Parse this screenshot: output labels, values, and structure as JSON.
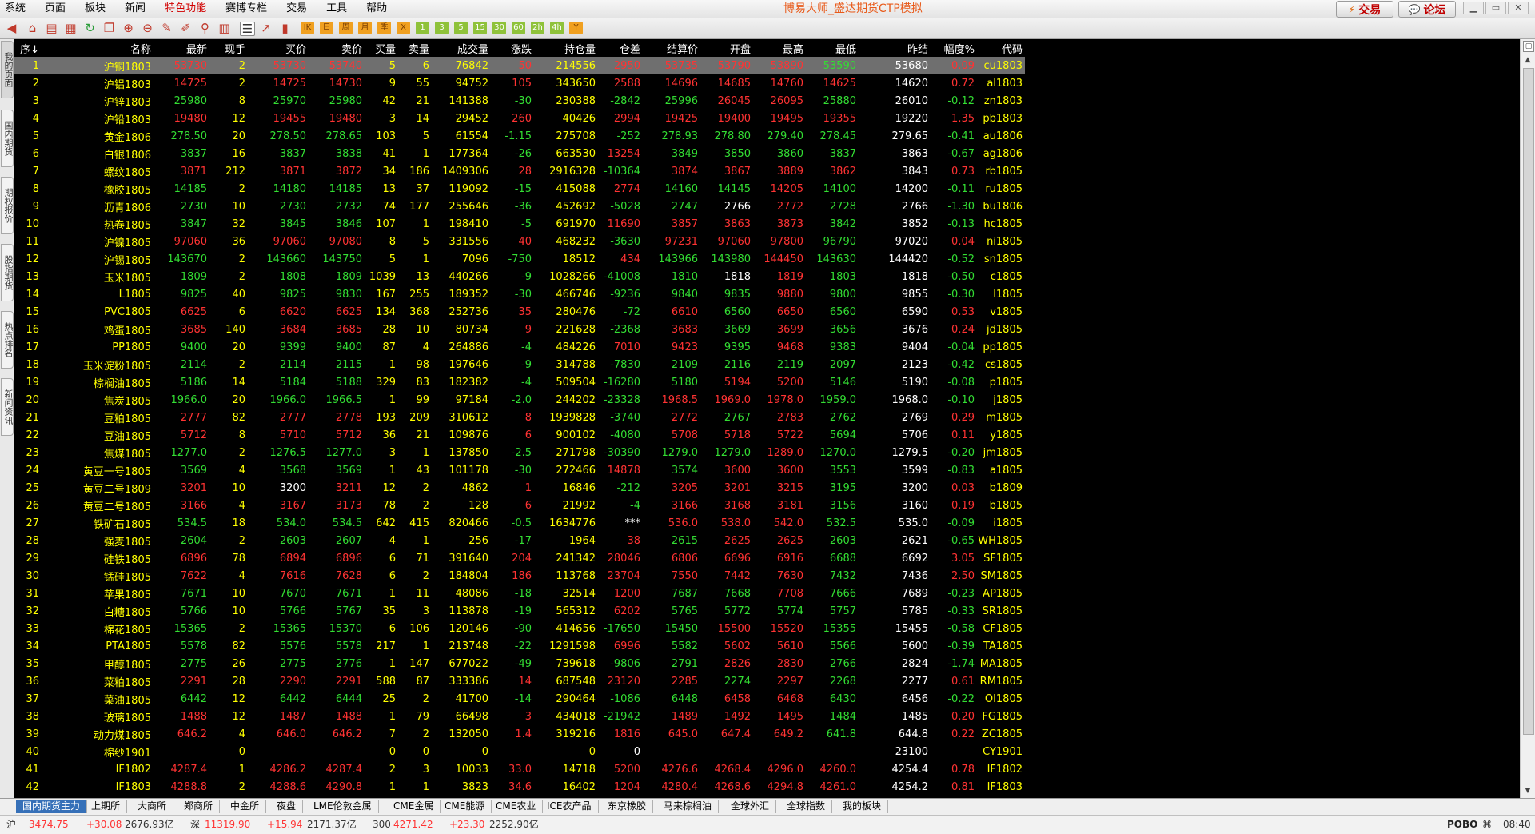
{
  "menu": {
    "items": [
      "系统",
      "页面",
      "板块",
      "新闻",
      "特色功能",
      "赛博专栏",
      "交易",
      "工具",
      "帮助"
    ],
    "highlight_index": 4
  },
  "app": {
    "title": "博易大师_盛达期货CTP模拟"
  },
  "top_buttons": {
    "trade": "交易",
    "forum": "论坛"
  },
  "toolbar": {
    "labels": [
      "IK",
      "日",
      "周",
      "月",
      "季",
      "X",
      "1",
      "3",
      "5",
      "15",
      "30",
      "60",
      "2h",
      "4h",
      "Y"
    ]
  },
  "sidebar": {
    "tabs": [
      "我的页面",
      "国内期货",
      "期权报价",
      "股指期货",
      "热点排名",
      "新闻资讯"
    ]
  },
  "table": {
    "headers": [
      "序↓",
      "名称",
      "最新",
      "现手",
      "买价",
      "卖价",
      "买量",
      "卖量",
      "成交量",
      "涨跌",
      "持仓量",
      "仓差",
      "结算价",
      "开盘",
      "最高",
      "最低",
      "昨结",
      "幅度%",
      "代码"
    ],
    "selected_index": 0,
    "rows": [
      [
        "1",
        "沪铜1803",
        "53730",
        "2",
        "53730",
        "53740",
        "5",
        "6",
        "76842",
        "50",
        "214556",
        "2950",
        "53735",
        "53790",
        "53890",
        "53590",
        "53680",
        "0.09",
        "cu1803"
      ],
      [
        "2",
        "沪铝1803",
        "14725",
        "2",
        "14725",
        "14730",
        "9",
        "55",
        "94752",
        "105",
        "343650",
        "2588",
        "14696",
        "14685",
        "14760",
        "14625",
        "14620",
        "0.72",
        "al1803"
      ],
      [
        "3",
        "沪锌1803",
        "25980",
        "8",
        "25970",
        "25980",
        "42",
        "21",
        "141388",
        "-30",
        "230388",
        "-2842",
        "25996",
        "26045",
        "26095",
        "25880",
        "26010",
        "-0.12",
        "zn1803"
      ],
      [
        "4",
        "沪铅1803",
        "19480",
        "12",
        "19455",
        "19480",
        "3",
        "14",
        "29452",
        "260",
        "40426",
        "2994",
        "19425",
        "19400",
        "19495",
        "19355",
        "19220",
        "1.35",
        "pb1803"
      ],
      [
        "5",
        "黄金1806",
        "278.50",
        "20",
        "278.50",
        "278.65",
        "103",
        "5",
        "61554",
        "-1.15",
        "275708",
        "-252",
        "278.93",
        "278.80",
        "279.40",
        "278.45",
        "279.65",
        "-0.41",
        "au1806"
      ],
      [
        "6",
        "白银1806",
        "3837",
        "16",
        "3837",
        "3838",
        "41",
        "1",
        "177364",
        "-26",
        "663530",
        "13254",
        "3849",
        "3850",
        "3860",
        "3837",
        "3863",
        "-0.67",
        "ag1806"
      ],
      [
        "7",
        "螺纹1805",
        "3871",
        "212",
        "3871",
        "3872",
        "34",
        "186",
        "1409306",
        "28",
        "2916328",
        "-10364",
        "3874",
        "3867",
        "3889",
        "3862",
        "3843",
        "0.73",
        "rb1805"
      ],
      [
        "8",
        "橡胶1805",
        "14185",
        "2",
        "14180",
        "14185",
        "13",
        "37",
        "119092",
        "-15",
        "415088",
        "2774",
        "14160",
        "14145",
        "14205",
        "14100",
        "14200",
        "-0.11",
        "ru1805"
      ],
      [
        "9",
        "沥青1806",
        "2730",
        "10",
        "2730",
        "2732",
        "74",
        "177",
        "255646",
        "-36",
        "452692",
        "-5028",
        "2747",
        "2766",
        "2772",
        "2728",
        "2766",
        "-1.30",
        "bu1806"
      ],
      [
        "10",
        "热卷1805",
        "3847",
        "32",
        "3845",
        "3846",
        "107",
        "1",
        "198410",
        "-5",
        "691970",
        "11690",
        "3857",
        "3863",
        "3873",
        "3842",
        "3852",
        "-0.13",
        "hc1805"
      ],
      [
        "11",
        "沪镍1805",
        "97060",
        "36",
        "97060",
        "97080",
        "8",
        "5",
        "331556",
        "40",
        "468232",
        "-3630",
        "97231",
        "97060",
        "97800",
        "96790",
        "97020",
        "0.04",
        "ni1805"
      ],
      [
        "12",
        "沪锡1805",
        "143670",
        "2",
        "143660",
        "143750",
        "5",
        "1",
        "7096",
        "-750",
        "18512",
        "434",
        "143966",
        "143980",
        "144450",
        "143630",
        "144420",
        "-0.52",
        "sn1805"
      ],
      [
        "13",
        "玉米1805",
        "1809",
        "2",
        "1808",
        "1809",
        "1039",
        "13",
        "440266",
        "-9",
        "1028266",
        "-41008",
        "1810",
        "1818",
        "1819",
        "1803",
        "1818",
        "-0.50",
        "c1805"
      ],
      [
        "14",
        "L1805",
        "9825",
        "40",
        "9825",
        "9830",
        "167",
        "255",
        "189352",
        "-30",
        "466746",
        "-9236",
        "9840",
        "9835",
        "9880",
        "9800",
        "9855",
        "-0.30",
        "l1805"
      ],
      [
        "15",
        "PVC1805",
        "6625",
        "6",
        "6620",
        "6625",
        "134",
        "368",
        "252736",
        "35",
        "280476",
        "-72",
        "6610",
        "6560",
        "6650",
        "6560",
        "6590",
        "0.53",
        "v1805"
      ],
      [
        "16",
        "鸡蛋1805",
        "3685",
        "140",
        "3684",
        "3685",
        "28",
        "10",
        "80734",
        "9",
        "221628",
        "-2368",
        "3683",
        "3669",
        "3699",
        "3656",
        "3676",
        "0.24",
        "jd1805"
      ],
      [
        "17",
        "PP1805",
        "9400",
        "20",
        "9399",
        "9400",
        "87",
        "4",
        "264886",
        "-4",
        "484226",
        "7010",
        "9423",
        "9395",
        "9468",
        "9383",
        "9404",
        "-0.04",
        "pp1805"
      ],
      [
        "18",
        "玉米淀粉1805",
        "2114",
        "2",
        "2114",
        "2115",
        "1",
        "98",
        "197646",
        "-9",
        "314788",
        "-7830",
        "2109",
        "2116",
        "2119",
        "2097",
        "2123",
        "-0.42",
        "cs1805"
      ],
      [
        "19",
        "棕榈油1805",
        "5186",
        "14",
        "5184",
        "5188",
        "329",
        "83",
        "182382",
        "-4",
        "509504",
        "-16280",
        "5180",
        "5194",
        "5200",
        "5146",
        "5190",
        "-0.08",
        "p1805"
      ],
      [
        "20",
        "焦炭1805",
        "1966.0",
        "20",
        "1966.0",
        "1966.5",
        "1",
        "99",
        "97184",
        "-2.0",
        "244202",
        "-23328",
        "1968.5",
        "1969.0",
        "1978.0",
        "1959.0",
        "1968.0",
        "-0.10",
        "j1805"
      ],
      [
        "21",
        "豆粕1805",
        "2777",
        "82",
        "2777",
        "2778",
        "193",
        "209",
        "310612",
        "8",
        "1939828",
        "-3740",
        "2772",
        "2767",
        "2783",
        "2762",
        "2769",
        "0.29",
        "m1805"
      ],
      [
        "22",
        "豆油1805",
        "5712",
        "8",
        "5710",
        "5712",
        "36",
        "21",
        "109876",
        "6",
        "900102",
        "-4080",
        "5708",
        "5718",
        "5722",
        "5694",
        "5706",
        "0.11",
        "y1805"
      ],
      [
        "23",
        "焦煤1805",
        "1277.0",
        "2",
        "1276.5",
        "1277.0",
        "3",
        "1",
        "137850",
        "-2.5",
        "271798",
        "-30390",
        "1279.0",
        "1279.0",
        "1289.0",
        "1270.0",
        "1279.5",
        "-0.20",
        "jm1805"
      ],
      [
        "24",
        "黄豆一号1805",
        "3569",
        "4",
        "3568",
        "3569",
        "1",
        "43",
        "101178",
        "-30",
        "272466",
        "14878",
        "3574",
        "3600",
        "3600",
        "3553",
        "3599",
        "-0.83",
        "a1805"
      ],
      [
        "25",
        "黄豆二号1809",
        "3201",
        "10",
        "3200",
        "3211",
        "12",
        "2",
        "4862",
        "1",
        "16846",
        "-212",
        "3205",
        "3201",
        "3215",
        "3195",
        "3200",
        "0.03",
        "b1809"
      ],
      [
        "26",
        "黄豆二号1805",
        "3166",
        "4",
        "3167",
        "3173",
        "78",
        "2",
        "128",
        "6",
        "21992",
        "-4",
        "3166",
        "3168",
        "3181",
        "3156",
        "3160",
        "0.19",
        "b1805"
      ],
      [
        "27",
        "铁矿石1805",
        "534.5",
        "18",
        "534.0",
        "534.5",
        "642",
        "415",
        "820466",
        "-0.5",
        "1634776",
        "***",
        "536.0",
        "538.0",
        "542.0",
        "532.5",
        "535.0",
        "-0.09",
        "i1805"
      ],
      [
        "28",
        "强麦1805",
        "2604",
        "2",
        "2603",
        "2607",
        "4",
        "1",
        "256",
        "-17",
        "1964",
        "38",
        "2615",
        "2625",
        "2625",
        "2603",
        "2621",
        "-0.65",
        "WH1805"
      ],
      [
        "29",
        "硅铁1805",
        "6896",
        "78",
        "6894",
        "6896",
        "6",
        "71",
        "391640",
        "204",
        "241342",
        "28046",
        "6806",
        "6696",
        "6916",
        "6688",
        "6692",
        "3.05",
        "SF1805"
      ],
      [
        "30",
        "锰硅1805",
        "7622",
        "4",
        "7616",
        "7628",
        "6",
        "2",
        "184804",
        "186",
        "113768",
        "23704",
        "7550",
        "7442",
        "7630",
        "7432",
        "7436",
        "2.50",
        "SM1805"
      ],
      [
        "31",
        "苹果1805",
        "7671",
        "10",
        "7670",
        "7671",
        "1",
        "11",
        "48086",
        "-18",
        "32514",
        "1200",
        "7687",
        "7668",
        "7708",
        "7666",
        "7689",
        "-0.23",
        "AP1805"
      ],
      [
        "32",
        "白糖1805",
        "5766",
        "10",
        "5766",
        "5767",
        "35",
        "3",
        "113878",
        "-19",
        "565312",
        "6202",
        "5765",
        "5772",
        "5774",
        "5757",
        "5785",
        "-0.33",
        "SR1805"
      ],
      [
        "33",
        "棉花1805",
        "15365",
        "2",
        "15365",
        "15370",
        "6",
        "106",
        "120146",
        "-90",
        "414656",
        "-17650",
        "15450",
        "15500",
        "15520",
        "15355",
        "15455",
        "-0.58",
        "CF1805"
      ],
      [
        "34",
        "PTA1805",
        "5578",
        "82",
        "5576",
        "5578",
        "217",
        "1",
        "213748",
        "-22",
        "1291598",
        "6996",
        "5582",
        "5602",
        "5610",
        "5566",
        "5600",
        "-0.39",
        "TA1805"
      ],
      [
        "35",
        "甲醇1805",
        "2775",
        "26",
        "2775",
        "2776",
        "1",
        "147",
        "677022",
        "-49",
        "739618",
        "-9806",
        "2791",
        "2826",
        "2830",
        "2766",
        "2824",
        "-1.74",
        "MA1805"
      ],
      [
        "36",
        "菜粕1805",
        "2291",
        "28",
        "2290",
        "2291",
        "588",
        "87",
        "333386",
        "14",
        "687548",
        "23120",
        "2285",
        "2274",
        "2297",
        "2268",
        "2277",
        "0.61",
        "RM1805"
      ],
      [
        "37",
        "菜油1805",
        "6442",
        "12",
        "6442",
        "6444",
        "25",
        "2",
        "41700",
        "-14",
        "290464",
        "-1086",
        "6448",
        "6458",
        "6468",
        "6430",
        "6456",
        "-0.22",
        "OI1805"
      ],
      [
        "38",
        "玻璃1805",
        "1488",
        "12",
        "1487",
        "1488",
        "1",
        "79",
        "66498",
        "3",
        "434018",
        "-21942",
        "1489",
        "1492",
        "1495",
        "1484",
        "1485",
        "0.20",
        "FG1805"
      ],
      [
        "39",
        "动力煤1805",
        "646.2",
        "4",
        "646.0",
        "646.2",
        "7",
        "2",
        "132050",
        "1.4",
        "319216",
        "1816",
        "645.0",
        "647.4",
        "649.2",
        "641.8",
        "644.8",
        "0.22",
        "ZC1805"
      ],
      [
        "40",
        "棉纱1901",
        "—",
        "0",
        "—",
        "—",
        "0",
        "0",
        "0",
        "—",
        "0",
        "0",
        "—",
        "—",
        "—",
        "—",
        "23100",
        "—",
        "CY1901"
      ],
      [
        "41",
        "IF1802",
        "4287.4",
        "1",
        "4286.2",
        "4287.4",
        "2",
        "3",
        "10033",
        "33.0",
        "14718",
        "5200",
        "4276.6",
        "4268.4",
        "4296.0",
        "4260.0",
        "4254.4",
        "0.78",
        "IF1802"
      ],
      [
        "42",
        "IF1803",
        "4288.8",
        "2",
        "4288.6",
        "4290.8",
        "1",
        "1",
        "3823",
        "34.6",
        "16402",
        "1204",
        "4280.4",
        "4268.6",
        "4294.8",
        "4261.0",
        "4254.2",
        "0.81",
        "IF1803"
      ]
    ]
  },
  "bottom_tabs": [
    "国内期货主力",
    "上期所",
    "大商所",
    "郑商所",
    "中金所",
    "夜盘",
    "LME伦敦金属",
    "CME金属",
    "CME能源",
    "CME农业",
    "ICE农产品",
    "东京橡胶",
    "马来棕榈油",
    "全球外汇",
    "全球指数",
    "我的板块"
  ],
  "status": {
    "sh_label": "沪",
    "sh_value": "3474.75",
    "sh_change": "+30.08",
    "sh_amount": "2676.93亿",
    "sz_label": "深",
    "sz_value": "11319.90",
    "sz_change": "+15.94",
    "sz_amount": "2171.37亿",
    "i300_label": "300",
    "i300_value": "4271.42",
    "i300_change": "+23.30",
    "i300_amount": "2252.90亿",
    "brand": "POBO",
    "time": "08:40"
  },
  "colors": {
    "up": "#ff3333",
    "down": "#33dd33",
    "neutral": "#ffff00",
    "selected_row": "#6f6f6f",
    "active_tab": "#3670b8"
  }
}
